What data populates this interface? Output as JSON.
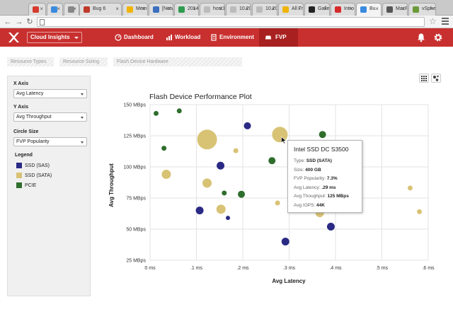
{
  "browser": {
    "tabs": [
      {
        "label": "",
        "color": "#d63b2f",
        "active": false
      },
      {
        "label": "",
        "color": "#3a8be0",
        "active": false
      },
      {
        "label": "",
        "color": "#888888",
        "active": false
      },
      {
        "label": "Bug 6",
        "color": "#c0392b",
        "active": false
      },
      {
        "label": "Mem",
        "color": "#f0b400",
        "active": false
      },
      {
        "label": "[Netw",
        "color": "#3b6fc0",
        "active": false
      },
      {
        "label": "2014",
        "color": "#2e9b4e",
        "active": false
      },
      {
        "label": "host1",
        "color": "#bbbbbb",
        "active": false
      },
      {
        "label": "10.20",
        "color": "#bbbbbb",
        "active": false
      },
      {
        "label": "10.20",
        "color": "#bbbbbb",
        "active": false
      },
      {
        "label": "All Tr",
        "color": "#f0b400",
        "active": false
      },
      {
        "label": "Galle",
        "color": "#222222",
        "active": false
      },
      {
        "label": "Intro",
        "color": "#d62b2b",
        "active": false
      },
      {
        "label": "Bu",
        "color": "#3a8be0",
        "active": true
      },
      {
        "label": "MacR",
        "color": "#555555",
        "active": false
      },
      {
        "label": "vSphe",
        "color": "#6a9a3a",
        "active": false
      }
    ]
  },
  "app": {
    "name": "Cloud Insights",
    "nav": [
      {
        "label": "Dashboard",
        "icon": "dashboard-icon"
      },
      {
        "label": "Workload",
        "icon": "workload-icon"
      },
      {
        "label": "Environment",
        "icon": "environment-icon"
      },
      {
        "label": "FVP",
        "icon": "fvp-icon",
        "active": true
      }
    ],
    "accent": "#c8302f"
  },
  "subnav": {
    "tabs": [
      "Resource Types",
      "Resource Sizing",
      "Flash Device Hardware"
    ]
  },
  "sidebar": {
    "x_axis_label": "X Axis",
    "x_axis_value": "Avg Latency",
    "y_axis_label": "Y Axis",
    "y_axis_value": "Avg Throughput",
    "circle_size_label": "Circle Size",
    "circle_size_value": "FVP Popularity",
    "legend_title": "Legend",
    "legend": [
      {
        "label": "SSD (SAS)",
        "color": "#2a2a85"
      },
      {
        "label": "SSD (SATA)",
        "color": "#d8c375"
      },
      {
        "label": "PCIE",
        "color": "#2f6e2c"
      }
    ]
  },
  "chart_data": {
    "type": "scatter",
    "title": "Flash Device Performance Plot",
    "xlabel": "Avg Latency",
    "ylabel": "Avg Throughput",
    "xlim": [
      0,
      0.6
    ],
    "ylim": [
      25,
      150
    ],
    "x_ticks": [
      {
        "v": 0,
        "label": "0 ms"
      },
      {
        "v": 0.1,
        "label": ".1 ms"
      },
      {
        "v": 0.2,
        "label": ".2 ms"
      },
      {
        "v": 0.3,
        "label": ".3 ms"
      },
      {
        "v": 0.4,
        "label": ".4 ms"
      },
      {
        "v": 0.5,
        "label": ".5 ms"
      },
      {
        "v": 0.6,
        "label": ".6 ms"
      }
    ],
    "y_ticks": [
      {
        "v": 25,
        "label": "25 MBps"
      },
      {
        "v": 50,
        "label": "50 MBps"
      },
      {
        "v": 75,
        "label": "75 MBps"
      },
      {
        "v": 100,
        "label": "100 MBps"
      },
      {
        "v": 125,
        "label": "125 MBps"
      },
      {
        "v": 150,
        "label": "150 MBps"
      }
    ],
    "grid": true,
    "series": [
      {
        "name": "SSD (SAS)",
        "color": "#2a2a85",
        "points": [
          {
            "x": 0.21,
            "y": 133,
            "r": 5
          },
          {
            "x": 0.152,
            "y": 101,
            "r": 5.5
          },
          {
            "x": 0.107,
            "y": 65,
            "r": 5.5
          },
          {
            "x": 0.168,
            "y": 59,
            "r": 3
          },
          {
            "x": 0.292,
            "y": 40,
            "r": 5.5
          },
          {
            "x": 0.39,
            "y": 52,
            "r": 5.5
          }
        ]
      },
      {
        "name": "SSD (SATA)",
        "color": "#d8c375",
        "points": [
          {
            "x": 0.123,
            "y": 122,
            "r": 14
          },
          {
            "x": 0.28,
            "y": 126,
            "r": 11
          },
          {
            "x": 0.185,
            "y": 113,
            "r": 3.5
          },
          {
            "x": 0.035,
            "y": 94,
            "r": 6.5
          },
          {
            "x": 0.123,
            "y": 87,
            "r": 6.5
          },
          {
            "x": 0.153,
            "y": 66,
            "r": 6.5
          },
          {
            "x": 0.275,
            "y": 71,
            "r": 3.5
          },
          {
            "x": 0.366,
            "y": 63,
            "r": 6
          },
          {
            "x": 0.561,
            "y": 83,
            "r": 3.5
          },
          {
            "x": 0.581,
            "y": 64,
            "r": 3.5
          }
        ]
      },
      {
        "name": "PCIE",
        "color": "#2f6e2c",
        "points": [
          {
            "x": 0.013,
            "y": 143,
            "r": 3.5
          },
          {
            "x": 0.063,
            "y": 145,
            "r": 3.5
          },
          {
            "x": 0.03,
            "y": 115,
            "r": 3.5
          },
          {
            "x": 0.16,
            "y": 79,
            "r": 3.5
          },
          {
            "x": 0.197,
            "y": 78,
            "r": 5
          },
          {
            "x": 0.263,
            "y": 105,
            "r": 5
          },
          {
            "x": 0.372,
            "y": 126,
            "r": 5
          }
        ]
      }
    ],
    "highlight": {
      "x": 0.44,
      "y": 103,
      "r": 10,
      "color": "#dcdcef"
    }
  },
  "tooltip": {
    "title": "Intel SSD DC S3500",
    "rows": [
      {
        "label": "Type:",
        "value": "SSD (SATA)"
      },
      {
        "label": "Size:",
        "value": "400 GB"
      },
      {
        "label": "FVP Popularity:",
        "value": "7.3%"
      },
      {
        "label": "Avg Latency:",
        "value": ".29 ms"
      },
      {
        "label": "Avg Thoughput:",
        "value": "125 MBps"
      },
      {
        "label": "Avg IOPS:",
        "value": "44K"
      }
    ]
  }
}
